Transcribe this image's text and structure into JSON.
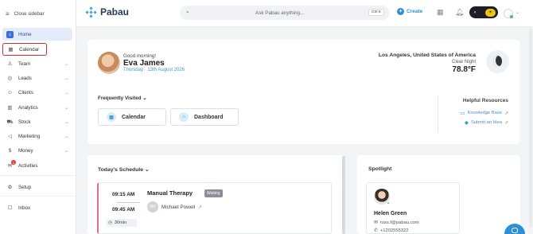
{
  "sidebar": {
    "close_label": "Close sidebar",
    "items": [
      {
        "label": "Home",
        "icon": "home-icon",
        "glyph": "⌂"
      },
      {
        "label": "Calendar",
        "icon": "calendar-icon",
        "glyph": "▦"
      },
      {
        "label": "Team",
        "icon": "team-icon",
        "glyph": "♙"
      },
      {
        "label": "Leads",
        "icon": "leads-icon",
        "glyph": "◎"
      },
      {
        "label": "Clients",
        "icon": "clients-icon",
        "glyph": "☺"
      },
      {
        "label": "Analytics",
        "icon": "analytics-icon",
        "glyph": "▥"
      },
      {
        "label": "Stock",
        "icon": "stock-icon",
        "glyph": "⛟"
      },
      {
        "label": "Marketing",
        "icon": "marketing-icon",
        "glyph": "◁"
      },
      {
        "label": "Money",
        "icon": "money-icon",
        "glyph": "$"
      },
      {
        "label": "Activities",
        "icon": "activities-icon",
        "glyph": "✉",
        "badge": "1"
      },
      {
        "label": "Setup",
        "icon": "setup-icon",
        "glyph": "⚙"
      },
      {
        "label": "Inbox",
        "icon": "inbox-icon",
        "glyph": "☐"
      }
    ]
  },
  "topbar": {
    "brand": "Pabau",
    "search_placeholder": "Ask Pabau anything...",
    "shortcut": "Ctrl K",
    "create_label": "Create"
  },
  "welcome": {
    "greeting": "Good morning!",
    "name": "Eva James",
    "date": "Thursday · 13th August 2026",
    "location": "Los Angeles, United States of America",
    "condition": "Clear Night",
    "temperature": "78.8°F"
  },
  "frequently_visited": {
    "title": "Frequently Visited",
    "items": [
      "Calendar",
      "Dashboard"
    ]
  },
  "helpful_resources": {
    "title": "Helpful Resources",
    "links": [
      "Knowledge Base",
      "Submit an Idea"
    ]
  },
  "schedule": {
    "title": "Today's Schedule",
    "appointment": {
      "start": "09:15 AM",
      "end": "09:45 AM",
      "duration": "30min",
      "service": "Manual Therapy",
      "status": "Waiting",
      "staff_initials": "MP",
      "staff": "Michael Powell"
    }
  },
  "spotlight": {
    "title": "Spotlight",
    "person": {
      "name": "Helen Green",
      "email": "russ.f@pabau.com",
      "phone": "+1202555322"
    }
  },
  "colors": {
    "accent": "#2d8fd5",
    "active_nav": "#3b6fd8",
    "highlight_border": "#d62b2b",
    "appointment_stripe": "#e66b8a"
  }
}
